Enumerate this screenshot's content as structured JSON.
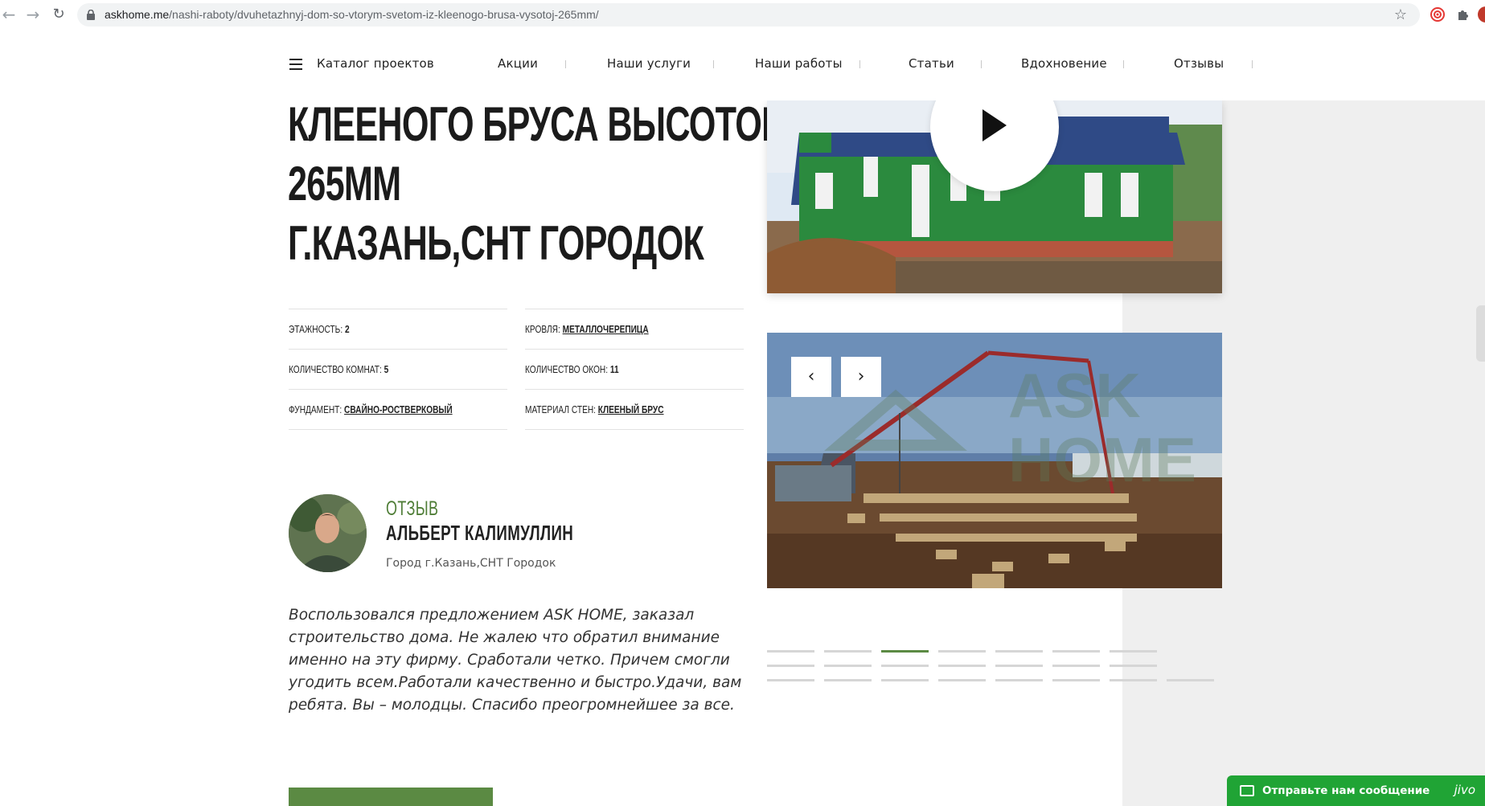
{
  "browser": {
    "url_host": "askhome.me",
    "url_path": "/nashi-raboty/dvuhetazhnyj-dom-so-vtorym-svetom-iz-kleenogo-brusa-vysotoj-265mm/",
    "back_icon": "back-arrow-icon",
    "forward_icon": "forward-arrow-icon",
    "reload_icon": "reload-icon"
  },
  "nav": {
    "catalog": "Каталог проектов",
    "items": [
      "Акции",
      "Наши услуги",
      "Наши работы",
      "Статьи",
      "Вдохновение",
      "Отзывы"
    ]
  },
  "title": {
    "line1": "КЛЕЕНОГО БРУСА ВЫСОТОЙ",
    "line2": "265ММ",
    "line3": "Г.КАЗАНЬ,СНТ ГОРОДОК"
  },
  "props": [
    {
      "label": "Этажность:",
      "value": "2",
      "link": false
    },
    {
      "label": "Кровля:",
      "value": "МЕТАЛЛОЧЕРЕПИЦА",
      "link": true
    },
    {
      "label": "Количество комнат:",
      "value": "5",
      "link": false
    },
    {
      "label": "Количество окон:",
      "value": "11",
      "link": false
    },
    {
      "label": "Фундамент:",
      "value": "СВАЙНО-РОСТВЕРКОВЫЙ",
      "link": true
    },
    {
      "label": "Материал стен:",
      "value": "КЛЕЕНЫЙ БРУС",
      "link": true
    }
  ],
  "review": {
    "tag": "ОТЗЫВ",
    "name": "АЛЬБЕРТ КАЛИМУЛЛИН",
    "city": "Город г.Казань,СНТ Городок",
    "text": "Воспользовался предложением ASK HOME, заказал строительство дома. Не жалею что обратил внимание именно на эту фирму. Сработали четко. Причем смогли угодить всем.Работали качественно и быстро.Удачи, вам ребята. Вы – молодцы. Спасибо преогромнейшее за все."
  },
  "gallery": {
    "watermark_line1": "ASK",
    "watermark_line2": "HOME",
    "prev_icon": "chevron-left-icon",
    "next_icon": "chevron-right-icon",
    "dots_total": 15,
    "active_dot": 3
  },
  "chat": {
    "label": "Отправьте нам сообщение",
    "brand": "jivo"
  }
}
